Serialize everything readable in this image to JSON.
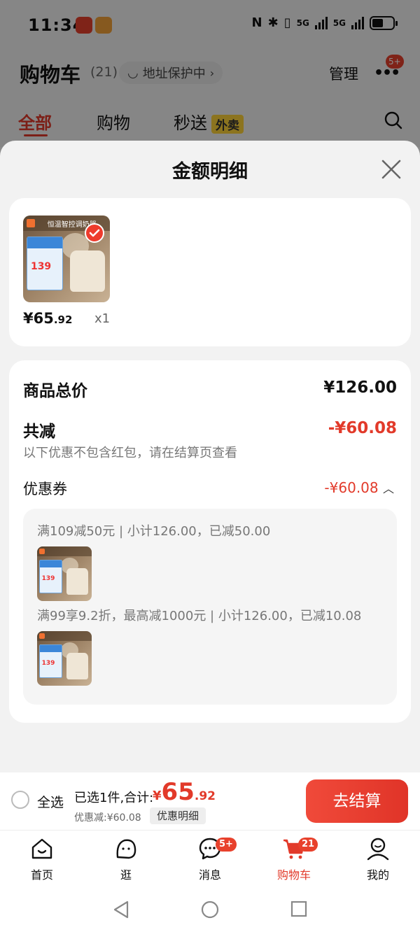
{
  "status": {
    "time": "11:34",
    "net1": "5G",
    "net2": "5G"
  },
  "header": {
    "title": "购物车",
    "count": "(21)",
    "address_protect": "地址保护中",
    "manage": "管理",
    "more_badge": "5+"
  },
  "tabs": [
    {
      "label": "全部"
    },
    {
      "label": "购物"
    },
    {
      "label": "秒送"
    }
  ],
  "tab_waimai": "外卖",
  "sheet": {
    "title": "金额明细",
    "item": {
      "price_int": "¥65",
      "price_dec": ".92",
      "qty": "x1",
      "thumb_title": "恒温智控调奶器",
      "thumb_price": "139"
    },
    "total_label": "商品总价",
    "total_value": "¥126.00",
    "reduce_label": "共减",
    "reduce_value": "-¥60.08",
    "note": "以下优惠不包含红包，请在结算页查看",
    "coupon_label": "优惠券",
    "coupon_value": "-¥60.08",
    "coupon_lines": [
      "满109减50元 | 小计126.00，已减50.00",
      "满99享9.2折，最高减1000元 | 小计126.00，已减10.08"
    ]
  },
  "bottom": {
    "select_all": "全选",
    "selected": "已选1件,合计:",
    "yen": "¥",
    "amount_int": "65",
    "amount_dec": ".92",
    "discount": "优惠减:¥60.08",
    "detail": "优惠明细",
    "checkout": "去结算"
  },
  "nav": [
    {
      "label": "首页"
    },
    {
      "label": "逛"
    },
    {
      "label": "消息",
      "badge": "5+"
    },
    {
      "label": "购物车",
      "badge": "21"
    },
    {
      "label": "我的"
    }
  ],
  "colors": {
    "accent": "#e23a2a"
  }
}
